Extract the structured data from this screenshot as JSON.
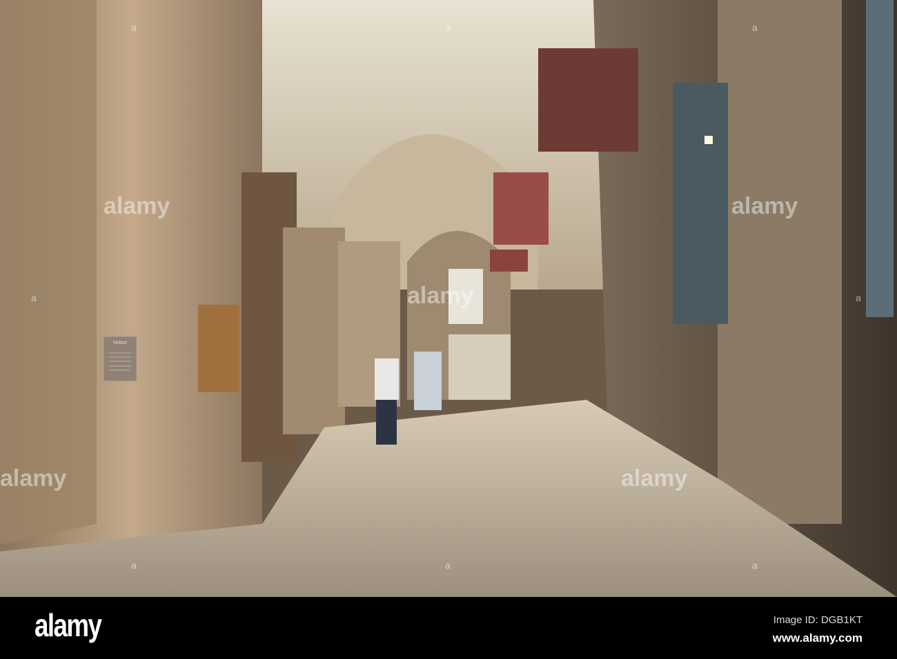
{
  "photo": {
    "subject": "cathedral aisle",
    "watermark_text": "alamy",
    "sign_text": "Notice"
  },
  "footer": {
    "logo": "alamy",
    "image_id": "Image ID: DGB1KT",
    "website": "www.alamy.com"
  },
  "colors": {
    "stone": "#b89c7c",
    "floor": "#c9b8a0",
    "background": "#000000"
  }
}
